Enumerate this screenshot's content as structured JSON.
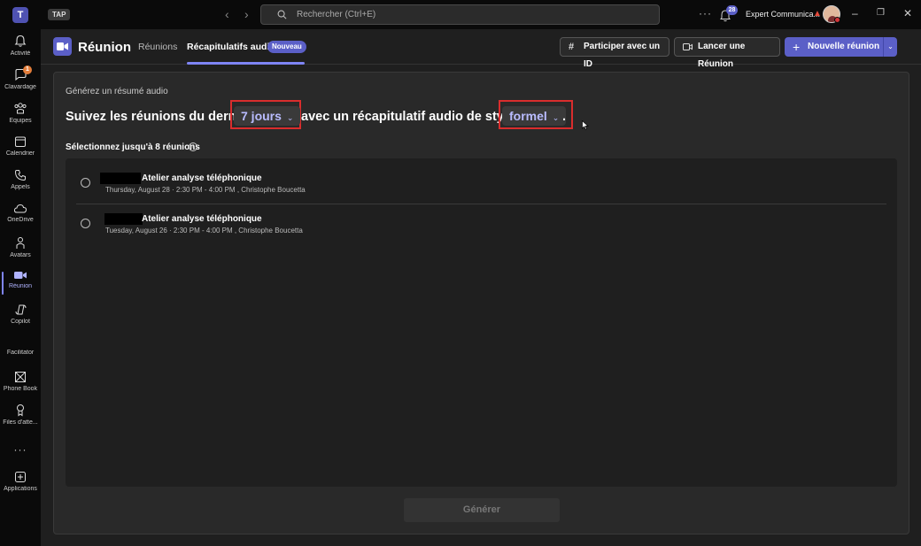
{
  "titlebar": {
    "tap_badge": "TAP",
    "search_placeholder": "Rechercher (Ctrl+E)",
    "notification_count": "28",
    "account_name": "Expert Communica..."
  },
  "rail": {
    "items": [
      {
        "label": "Activité",
        "icon": "bell-icon"
      },
      {
        "label": "Clavardage",
        "icon": "chat-icon",
        "badge": "1"
      },
      {
        "label": "Équipes",
        "icon": "teams-icon"
      },
      {
        "label": "Calendrier",
        "icon": "calendar-icon"
      },
      {
        "label": "Appels",
        "icon": "phone-icon"
      },
      {
        "label": "OneDrive",
        "icon": "cloud-icon"
      },
      {
        "label": "Avatars",
        "icon": "avatar-icon"
      },
      {
        "label": "Réunion",
        "icon": "video-icon"
      },
      {
        "label": "Copilot",
        "icon": "copilot-icon"
      },
      {
        "label": "Facilitator",
        "icon": ""
      },
      {
        "label": "Phone Book",
        "icon": "phonebook-icon"
      },
      {
        "label": "Files d'atte...",
        "icon": "queue-icon"
      },
      {
        "label": "Applications",
        "icon": "plus-square-icon"
      }
    ]
  },
  "header": {
    "title": "Réunion",
    "tabs": [
      {
        "label": "Réunions"
      },
      {
        "label": "Récapitulatifs audio",
        "active": true
      }
    ],
    "new_badge": "Nouveau",
    "join_id_label": "Participer avec un ID",
    "start_meeting_label": "Lancer une Réunion",
    "new_meeting_label": "Nouvelle réunion"
  },
  "main": {
    "small_title": "Générez un résumé audio",
    "sentence_part1": "Suivez les réunions du dernier",
    "days_value": "7 jours",
    "sentence_part2": "avec un récapitulatif audio de style",
    "style_value": "formel",
    "sentence_end": ".",
    "select_label": "Sélectionnez jusqu'à 8 réunions",
    "meetings": [
      {
        "title": "Atelier analyse téléphonique",
        "meta": "Thursday, August 28 · 2:30 PM - 4:00 PM , Christophe Boucetta"
      },
      {
        "title": "Atelier analyse téléphonique",
        "meta": "Tuesday, August 26 · 2:30 PM - 4:00 PM , Christophe Boucetta"
      }
    ],
    "generate_label": "Générer"
  },
  "colors": {
    "accent": "#5b5fc7",
    "highlight_box": "#d92d2d"
  }
}
